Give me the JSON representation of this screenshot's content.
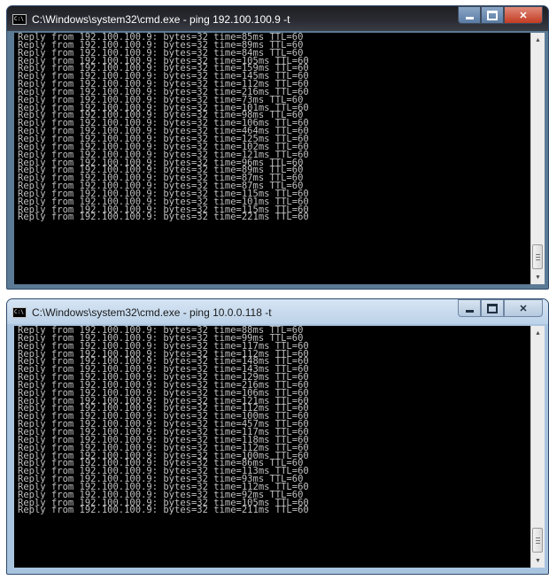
{
  "windows": [
    {
      "title": "C:\\Windows\\system32\\cmd.exe - ping  192.100.100.9 -t",
      "lines": [
        "Reply from 192.100.100.9: bytes=32 time=85ms TTL=60",
        "Reply from 192.100.100.9: bytes=32 time=89ms TTL=60",
        "Reply from 192.100.100.9: bytes=32 time=84ms TTL=60",
        "Reply from 192.100.100.9: bytes=32 time=105ms TTL=60",
        "Reply from 192.100.100.9: bytes=32 time=159ms TTL=60",
        "Reply from 192.100.100.9: bytes=32 time=145ms TTL=60",
        "Reply from 192.100.100.9: bytes=32 time=112ms TTL=60",
        "Reply from 192.100.100.9: bytes=32 time=216ms TTL=60",
        "Reply from 192.100.100.9: bytes=32 time=73ms TTL=60",
        "Reply from 192.100.100.9: bytes=32 time=101ms TTL=60",
        "Reply from 192.100.100.9: bytes=32 time=98ms TTL=60",
        "Reply from 192.100.100.9: bytes=32 time=106ms TTL=60",
        "Reply from 192.100.100.9: bytes=32 time=464ms TTL=60",
        "Reply from 192.100.100.9: bytes=32 time=125ms TTL=60",
        "Reply from 192.100.100.9: bytes=32 time=102ms TTL=60",
        "Reply from 192.100.100.9: bytes=32 time=121ms TTL=60",
        "Reply from 192.100.100.9: bytes=32 time=96ms TTL=60",
        "Reply from 192.100.100.9: bytes=32 time=89ms TTL=60",
        "Reply from 192.100.100.9: bytes=32 time=87ms TTL=60",
        "Reply from 192.100.100.9: bytes=32 time=87ms TTL=60",
        "Reply from 192.100.100.9: bytes=32 time=115ms TTL=60",
        "Reply from 192.100.100.9: bytes=32 time=101ms TTL=60",
        "Reply from 192.100.100.9: bytes=32 time=115ms TTL=60",
        "Reply from 192.100.100.9: bytes=32 time=221ms TTL=60"
      ]
    },
    {
      "title": "C:\\Windows\\system32\\cmd.exe - ping  10.0.0.118 -t",
      "lines": [
        "Reply from 192.100.100.9: bytes=32 time=88ms TTL=60",
        "Reply from 192.100.100.9: bytes=32 time=99ms TTL=60",
        "Reply from 192.100.100.9: bytes=32 time=117ms TTL=60",
        "Reply from 192.100.100.9: bytes=32 time=112ms TTL=60",
        "Reply from 192.100.100.9: bytes=32 time=148ms TTL=60",
        "Reply from 192.100.100.9: bytes=32 time=143ms TTL=60",
        "Reply from 192.100.100.9: bytes=32 time=129ms TTL=60",
        "Reply from 192.100.100.9: bytes=32 time=216ms TTL=60",
        "Reply from 192.100.100.9: bytes=32 time=106ms TTL=60",
        "Reply from 192.100.100.9: bytes=32 time=121ms TTL=60",
        "Reply from 192.100.100.9: bytes=32 time=112ms TTL=60",
        "Reply from 192.100.100.9: bytes=32 time=100ms TTL=60",
        "Reply from 192.100.100.9: bytes=32 time=457ms TTL=60",
        "Reply from 192.100.100.9: bytes=32 time=117ms TTL=60",
        "Reply from 192.100.100.9: bytes=32 time=118ms TTL=60",
        "Reply from 192.100.100.9: bytes=32 time=112ms TTL=60",
        "Reply from 192.100.100.9: bytes=32 time=100ms TTL=60",
        "Reply from 192.100.100.9: bytes=32 time=86ms TTL=60",
        "Reply from 192.100.100.9: bytes=32 time=113ms TTL=60",
        "Reply from 192.100.100.9: bytes=32 time=93ms TTL=60",
        "Reply from 192.100.100.9: bytes=32 time=112ms TTL=60",
        "Reply from 192.100.100.9: bytes=32 time=92ms TTL=60",
        "Reply from 192.100.100.9: bytes=32 time=105ms TTL=60",
        "Reply from 192.100.100.9: bytes=32 time=211ms TTL=60"
      ]
    }
  ],
  "icons": {
    "app": "cmd-icon",
    "minimize": "minimize-icon",
    "maximize": "maximize-icon",
    "close": "close-icon",
    "scroll_up": "scroll-up-arrow-icon",
    "scroll_down": "scroll-down-arrow-icon"
  },
  "colors": {
    "console_bg": "#000000",
    "console_text": "#c0c0c0",
    "close_button": "#c33b22"
  }
}
